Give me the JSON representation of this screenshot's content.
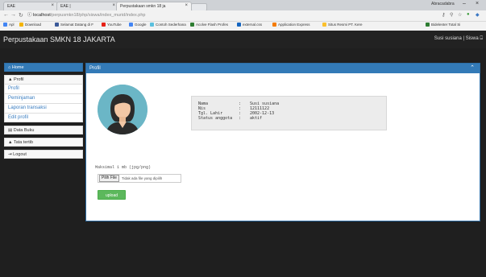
{
  "browser": {
    "tabs": [
      {
        "title": "EAE",
        "active": false
      },
      {
        "title": "EAE |",
        "active": false
      },
      {
        "title": "Perpustakaan smkn 18 ja",
        "active": true
      }
    ],
    "account": "Abracadabra",
    "url_host": "localhost",
    "url_path": "/perpusmkn18/php/siswa/index_murid/index.php",
    "bookmarks": [
      {
        "label": "Apl",
        "color": "#4285f4"
      },
      {
        "label": "Download",
        "color": "#f4b400"
      },
      {
        "label": "Selamat Datang di F",
        "color": "#3b5998"
      },
      {
        "label": "YouTube",
        "color": "#e62117"
      },
      {
        "label": "Google",
        "color": "#4285f4"
      },
      {
        "label": "Contoh Sederhana",
        "color": "#5bc0de"
      },
      {
        "label": "Acolve Flash Profes",
        "color": "#2e7d32"
      },
      {
        "label": "external.css",
        "color": "#1565c0"
      },
      {
        "label": "Application Express",
        "color": "#f57c00"
      },
      {
        "label": "Situs Resmi PT. Kere",
        "color": "#fbc02d"
      },
      {
        "label": "Bidelenter Total Si",
        "color": "#2e7d32"
      }
    ]
  },
  "app": {
    "brand": "Perpustakaan SMKN 18 JAKARTA",
    "user": "Susi susiana | Siswa"
  },
  "sidebar": {
    "home": "Home",
    "profil_header": "Profil",
    "profil_links": [
      "Profil",
      "Peminjaman",
      "Laporan transaksi",
      "Edit profil"
    ],
    "data_buku": "Data Buku",
    "tata_tertib": "Tata tertib",
    "logout": "Logout"
  },
  "panel": {
    "title": "Profil",
    "info": [
      {
        "key": "Nama",
        "value": "Susi susiana"
      },
      {
        "key": "Nis",
        "value": "12111122"
      },
      {
        "key": "Tgl. Lahir",
        "value": "2002-12-13"
      },
      {
        "key": "Status anggota",
        "value": "aktif"
      }
    ],
    "separator": ":",
    "max_note": "Maksimal 1 mb (jpg/png)",
    "file_button": "Pilih File",
    "file_status": "Tidak ada file yang dipilih",
    "upload_label": "upload"
  },
  "colors": {
    "primary": "#337ab7",
    "navbar": "#222222",
    "success": "#5cb85c",
    "avatar_bg": "#6bb6c6"
  }
}
